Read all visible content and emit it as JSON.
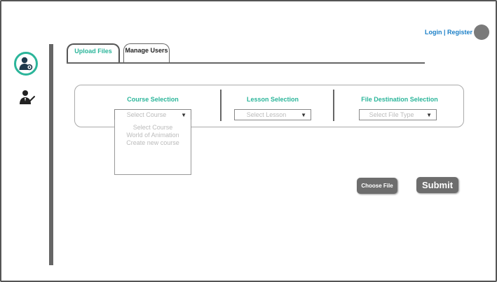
{
  "header": {
    "auth_link": "Login | Register",
    "avatar": "user-avatar"
  },
  "sidebar": {
    "items": [
      {
        "icon": "user-settings-icon",
        "active": true
      },
      {
        "icon": "teacher-icon",
        "active": false
      }
    ]
  },
  "tabs": [
    {
      "label": "Upload Files",
      "active": true
    },
    {
      "label": "Manage Users",
      "active": false
    }
  ],
  "selections": {
    "course": {
      "label": "Course Selection",
      "value": "Select Course"
    },
    "lesson": {
      "label": "Lesson Selection",
      "value": "Select Lesson"
    },
    "file_destination": {
      "label": "File Destination Selection",
      "value": "Select File Type"
    }
  },
  "course_dropdown": {
    "options": [
      "Select Course",
      "World of Animation",
      "Create new course"
    ]
  },
  "actions": {
    "choose_file": "Choose File",
    "submit": "Submit"
  },
  "colors": {
    "accent": "#2bb59a",
    "link": "#1a7fc7",
    "button": "#6d6d6d"
  }
}
